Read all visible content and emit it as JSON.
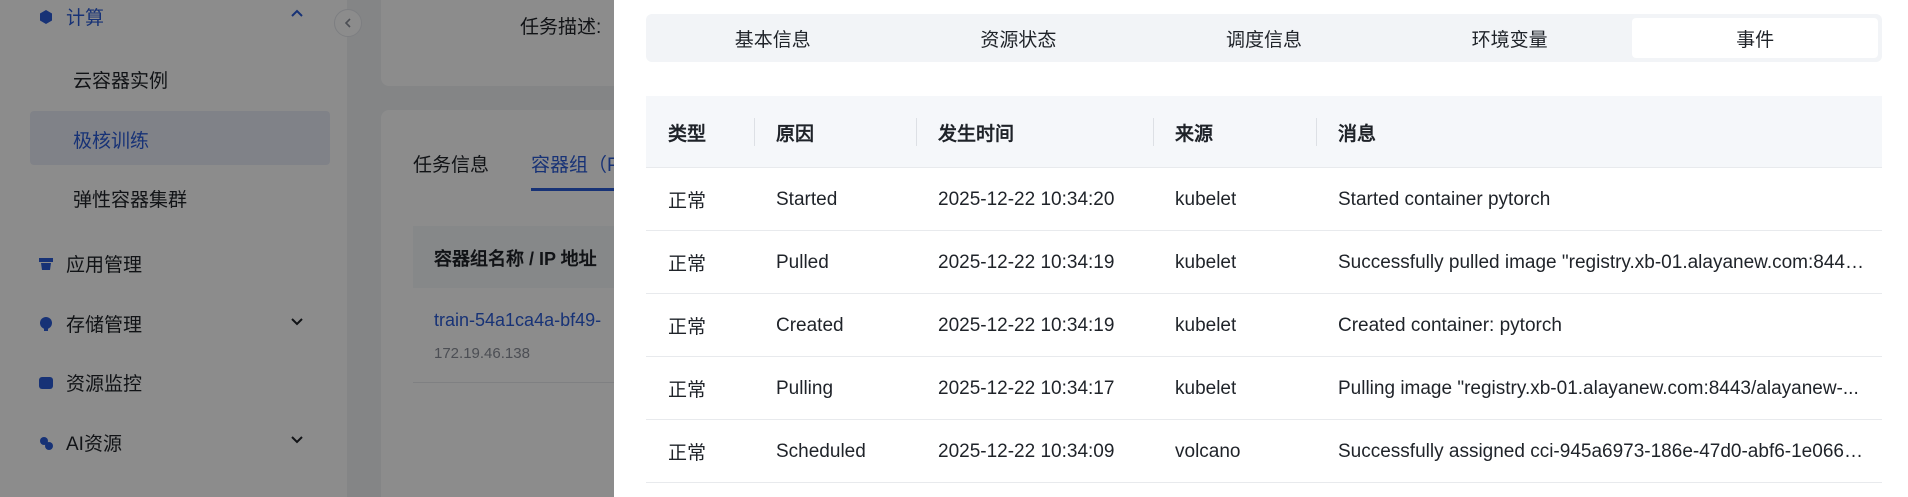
{
  "sidebar": {
    "groups": [
      {
        "label": "计算",
        "icon": "cube-icon",
        "expanded": true
      },
      {
        "label": "应用管理",
        "icon": "app-icon"
      },
      {
        "label": "存储管理",
        "icon": "storage-icon",
        "expanded": false
      },
      {
        "label": "资源监控",
        "icon": "monitor-icon"
      },
      {
        "label": "AI资源",
        "icon": "ai-icon",
        "expanded": false
      }
    ],
    "sub_items": [
      {
        "label": "云容器实例"
      },
      {
        "label": "极核训练",
        "active": true
      },
      {
        "label": "弹性容器集群"
      }
    ]
  },
  "background": {
    "task_desc_label": "任务描述:",
    "tabs": [
      "任务信息",
      "容器组（P"
    ],
    "table_header": "容器组名称 / IP 地址",
    "pod_name": "train-54a1ca4a-bf49-",
    "pod_ip": "172.19.46.138"
  },
  "drawer": {
    "tabs": [
      {
        "label": "基本信息"
      },
      {
        "label": "资源状态"
      },
      {
        "label": "调度信息"
      },
      {
        "label": "环境变量"
      },
      {
        "label": "事件",
        "active": true
      }
    ],
    "columns": [
      "类型",
      "原因",
      "发生时间",
      "来源",
      "消息"
    ],
    "rows": [
      {
        "type": "正常",
        "reason": "Started",
        "time": "2025-12-22 10:34:20",
        "source": "kubelet",
        "message": "Started container pytorch"
      },
      {
        "type": "正常",
        "reason": "Pulled",
        "time": "2025-12-22 10:34:19",
        "source": "kubelet",
        "message": "Successfully pulled image \"registry.xb-01.alayanew.com:8443..."
      },
      {
        "type": "正常",
        "reason": "Created",
        "time": "2025-12-22 10:34:19",
        "source": "kubelet",
        "message": "Created container: pytorch"
      },
      {
        "type": "正常",
        "reason": "Pulling",
        "time": "2025-12-22 10:34:17",
        "source": "kubelet",
        "message": "Pulling image \"registry.xb-01.alayanew.com:8443/alayanew-..."
      },
      {
        "type": "正常",
        "reason": "Scheduled",
        "time": "2025-12-22 10:34:09",
        "source": "volcano",
        "message": "Successfully assigned cci-945a6973-186e-47d0-abf6-1e0661..."
      }
    ]
  },
  "colors": {
    "accent": "#2b5cd8",
    "mask": "rgba(0,0,0,0.45)"
  }
}
